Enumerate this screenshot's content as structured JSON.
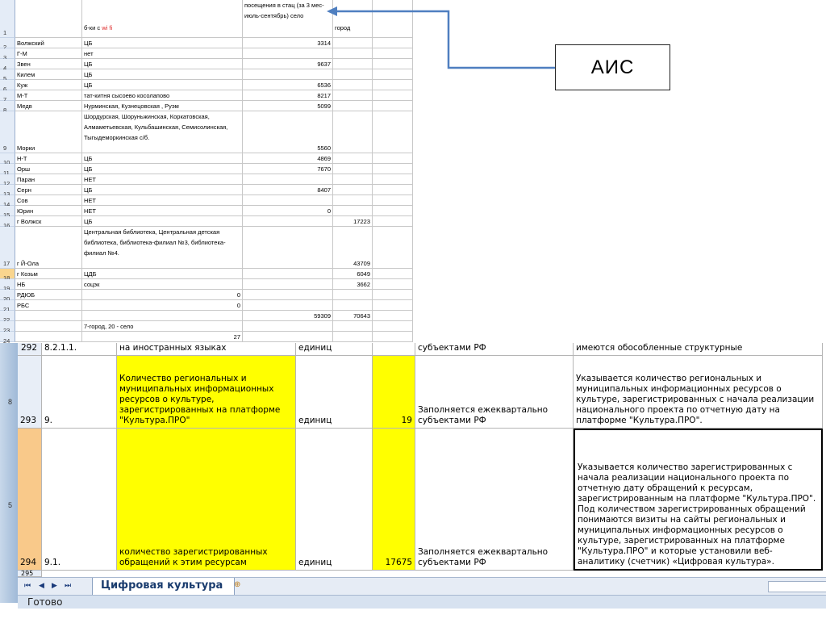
{
  "top_sheet": {
    "header": {
      "col_b": "б-ки с",
      "col_b_red": "wi fi",
      "col_c": "посещения в стац (за 3 мес-июль-сентябрь) село",
      "col_d": "город"
    },
    "rows": [
      {
        "n": "1",
        "a": "",
        "b": "",
        "c": "",
        "d": ""
      },
      {
        "n": "2",
        "a": "Волжский",
        "b": "ЦБ",
        "c": "3314",
        "d": ""
      },
      {
        "n": "3",
        "a": "Г-М",
        "b": "нет",
        "c": "",
        "d": ""
      },
      {
        "n": "4",
        "a": "Звен",
        "b": "ЦБ",
        "c": "9637",
        "d": ""
      },
      {
        "n": "5",
        "a": "Килем",
        "b": "ЦБ",
        "c": "",
        "d": ""
      },
      {
        "n": "6",
        "a": "Куж",
        "b": "ЦБ",
        "c": "6536",
        "d": ""
      },
      {
        "n": "7",
        "a": "М-Т",
        "b": "тат-китня сысоево косолапово",
        "c": "8217",
        "d": ""
      },
      {
        "n": "8",
        "a": "Медв",
        "b": "Нурминская, Кузнецовская , Руэм",
        "c": "5099",
        "d": ""
      },
      {
        "n": "9",
        "a": "Морки",
        "b": "Шордурская, Шоруньжинская, Коркатовская, Алмаметьевская, Кульбашинская, Семисолинская, Тыгыдеморкинская с/б.",
        "c": "5560",
        "d": ""
      },
      {
        "n": "10",
        "a": "Н-Т",
        "b": "ЦБ",
        "c": "4869",
        "d": ""
      },
      {
        "n": "11",
        "a": "Орш",
        "b": "ЦБ",
        "c": "7670",
        "d": ""
      },
      {
        "n": "12",
        "a": "Паран",
        "b": "НЕТ",
        "c": "",
        "d": ""
      },
      {
        "n": "13",
        "a": "Серн",
        "b": "ЦБ",
        "c": "8407",
        "d": ""
      },
      {
        "n": "14",
        "a": "Сов",
        "b": "НЕТ",
        "c": "",
        "d": ""
      },
      {
        "n": "15",
        "a": "Юрин",
        "b": "НЕТ",
        "c": "0",
        "d": ""
      },
      {
        "n": "16",
        "a": "г Волжск",
        "b": "ЦБ",
        "c": "",
        "d": "17223"
      },
      {
        "n": "17",
        "a": "г Й-Ола",
        "b": "Центральная библиотека, Центральная детская библиотека, библиотека-филиал №3, библиотека-филиал №4.",
        "c": "",
        "d": "43709"
      },
      {
        "n": "18",
        "a": "г Козьм",
        "b": "ЦДБ",
        "c": "",
        "d": "6049"
      },
      {
        "n": "19",
        "a": "НБ",
        "b": "соцэк",
        "c": "",
        "d": "3662"
      },
      {
        "n": "20",
        "a": "РДЮБ",
        "b": "0",
        "c": "",
        "d": ""
      },
      {
        "n": "21",
        "a": "РБС",
        "b": "0",
        "c": "",
        "d": ""
      },
      {
        "n": "22",
        "a": "",
        "b": "",
        "c": "59309",
        "d": "70643"
      },
      {
        "n": "23",
        "a": "",
        "b": "7-город, 20 - село",
        "c": "",
        "d": ""
      },
      {
        "n": "24",
        "a": "",
        "b": "27",
        "c": "",
        "d": ""
      }
    ]
  },
  "callout": {
    "label": "АИС"
  },
  "bottom_sheet": {
    "row292": {
      "n": "292",
      "code": "8.2.1.1.",
      "name": "на иностранных языках",
      "unit": "единиц",
      "value": "",
      "freq": "субъектами РФ",
      "desc": "имеются обособленные структурные"
    },
    "row293": {
      "n": "293",
      "code": "9.",
      "name": "Количество региональных и муниципальных информационных ресурсов о культуре, зарегистрированных на платформе \"Культура.ПРО\"",
      "unit": "единиц",
      "value": "19",
      "freq": "Заполняется ежеквартально субъектами РФ",
      "desc": "Указывается количество региональных и муниципальных информационных ресурсов о культуре, зарегистрированных с начала реализации национального проекта по отчетную дату на платформе \"Культура.ПРО\"."
    },
    "row294": {
      "n": "294",
      "code": "9.1.",
      "name": "количество зарегистрированных обращений к этим ресурсам",
      "unit": "единиц",
      "value": "17675",
      "freq": "Заполняется ежеквартально субъектами РФ",
      "desc": "Указывается количество зарегистрированных с начала реализации национального проекта по отчетную дату обращений к ресурсам, зарегистрированным на платформе \"Культура.ПРО\". Под количеством зарегистрированных обращений понимаются визиты на сайты региональных и муниципальных информационных ресурсов о культуре, зарегистрированных на платформе \"Культура.ПРО\" и которые установили веб-аналитику (счетчик) «Цифровая культура»."
    },
    "row295": {
      "n": "295"
    },
    "left_markers": {
      "m1": "8",
      "m2": "5"
    }
  },
  "sheet_tabs": {
    "active": "Цифровая культура"
  },
  "status_bar": {
    "text": "Готово"
  }
}
